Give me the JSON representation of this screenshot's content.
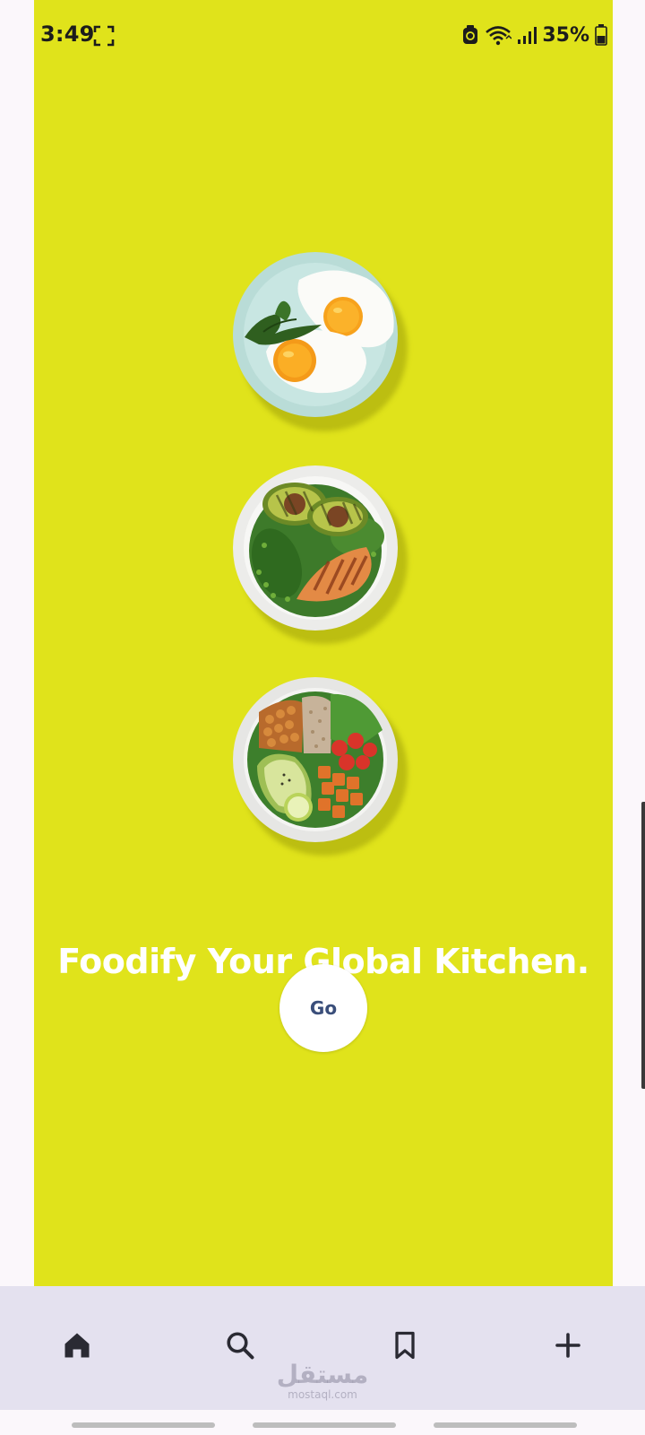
{
  "status_bar": {
    "time": "3:49",
    "battery_percent": "35%",
    "icons": [
      "screenshot-icon",
      "alarm-icon",
      "wifi-icon",
      "signal-icon",
      "battery-icon"
    ]
  },
  "main": {
    "background_color": "#e0e31b",
    "plates": [
      "fried-eggs-plate",
      "avocado-chicken-salad-plate",
      "grain-veggie-bowl-plate"
    ],
    "tagline": "Foodify Your Global Kitchen.",
    "go_button_label": "Go"
  },
  "bottom_nav": {
    "items": [
      {
        "icon": "home-icon"
      },
      {
        "icon": "search-icon"
      },
      {
        "icon": "bookmark-icon"
      },
      {
        "icon": "plus-icon"
      }
    ],
    "watermark": {
      "arabic": "مستقل",
      "latin": "mostaql.com"
    }
  }
}
